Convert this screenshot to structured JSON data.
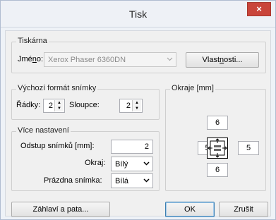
{
  "window": {
    "title": "Tisk",
    "close_label": "×"
  },
  "printer_group": {
    "legend": "Tiskárna",
    "name_label_pre": "Jmé",
    "name_label_u": "n",
    "name_label_post": "o:",
    "printer_value": "Xerox Phaser 6360DN",
    "properties_pre": "Vlast",
    "properties_u": "n",
    "properties_post": "osti..."
  },
  "format_group": {
    "legend": "Výchozí formát snímky",
    "rows_label": "Řádky:",
    "rows_value": "2",
    "cols_label": "Sloupce:",
    "cols_value": "2"
  },
  "more_group": {
    "legend": "Více nastavení",
    "spacing_label": "Odstup snímků [mm]:",
    "spacing_value": "2",
    "border_label": "Okraj:",
    "border_value": "Bílý",
    "empty_label": "Prázdna snímka:",
    "empty_value": "Bílá"
  },
  "margins_group": {
    "legend": "Okraje [mm]",
    "top": "6",
    "left": "5",
    "right": "5",
    "bottom": "6"
  },
  "footer": {
    "header_footer_label": "Záhlaví a pata...",
    "ok_label": "OK",
    "cancel_label": "Zrušit"
  }
}
